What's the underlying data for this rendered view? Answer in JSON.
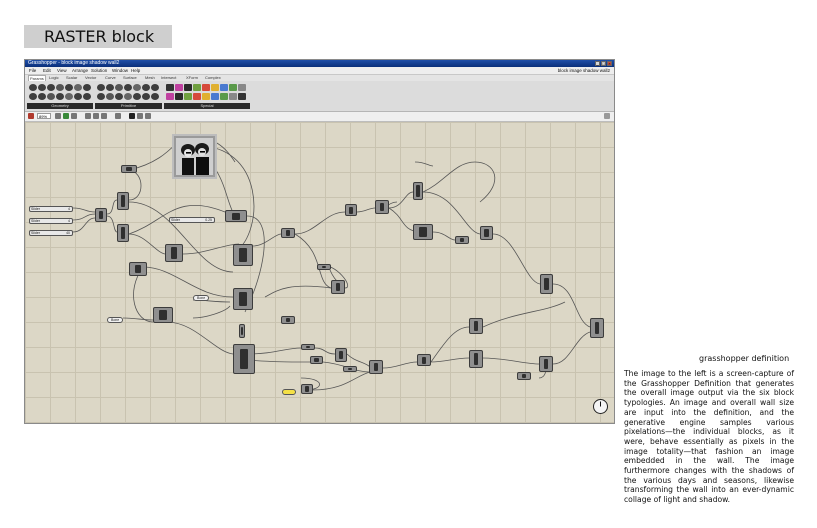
{
  "page": {
    "title": "RASTER block"
  },
  "window": {
    "title": "Grasshopper - block image shadow wall2",
    "document_name": "block image shadow wall2",
    "menu": [
      "File",
      "Edit",
      "View",
      "Arrange",
      "Solution",
      "Window",
      "Help"
    ],
    "tabs": [
      "Params",
      "Logic",
      "Scalar",
      "Vector",
      "Curve",
      "Surface",
      "Mesh",
      "Intersect",
      "XForm",
      "Complex"
    ],
    "active_tab": "Params",
    "component_groups": [
      "Geometry",
      "Primitive",
      "Special"
    ],
    "zoom": "89%"
  },
  "canvas": {
    "sliders": [
      {
        "label": "Slider",
        "value": "4"
      },
      {
        "label": "Slider",
        "value": "4"
      },
      {
        "label": "Slider",
        "value": "40"
      },
      {
        "label": "Slider",
        "value": "0.25"
      }
    ],
    "panels": [
      {
        "text": "Bone"
      },
      {
        "text": "Bone"
      },
      {
        "text": ""
      }
    ]
  },
  "caption": {
    "heading": "grasshopper definition",
    "body": "The image to the left is a screen-capture of the Grasshopper Definition that generates the overall image output via the six block typologies. An image and overall wall size are input into the definition, and the generative engine samples various pixelations—the individual blocks, as it were, behave essentially as pixels in the image totality—that fashion an image embedded in the wall. The image furthermore changes with the shadows of the various days and seasons, likewise transforming the wall into an ever-dynamic collage of light and shadow."
  },
  "colors": {
    "canvas": "#dcd7c6",
    "titlebar": "#0a2f7a",
    "node": "#8f8f8f",
    "panel_yellow": "#f4e046"
  }
}
